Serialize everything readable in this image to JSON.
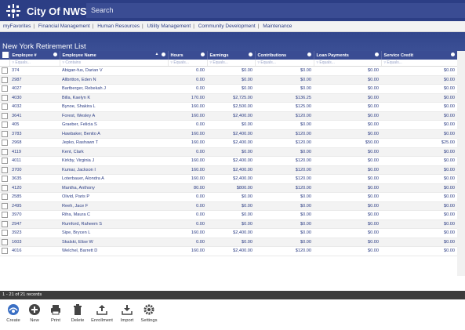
{
  "app": {
    "title": "City Of NWS",
    "search_placeholder": "Search"
  },
  "nav": {
    "items": [
      "myFavorites",
      "Financial Management",
      "Human Resources",
      "Utility Management",
      "Community Development",
      "Maintenance"
    ]
  },
  "page": {
    "title": "New York Retirement List"
  },
  "grid": {
    "columns": [
      "Employee #",
      "Employee Name",
      "Hours",
      "Earnings",
      "Contributions",
      "Loan Payments",
      "Service Credit"
    ],
    "filter_placeholders": [
      "Equals...",
      "Contains",
      "Equals...",
      "Equals...",
      "Equals...",
      "Equals...",
      "Equals..."
    ],
    "rows": [
      {
        "emp": "374",
        "name": "Abigan-fus, Darian V",
        "hours": "0.00",
        "earnings": "$0.00",
        "contrib": "$0.00",
        "loan": "$0.00",
        "credit": "$0.00"
      },
      {
        "emp": "2987",
        "name": "Allbritton, Eden N",
        "hours": "0.00",
        "earnings": "$0.00",
        "contrib": "$0.00",
        "loan": "$0.00",
        "credit": "$0.00"
      },
      {
        "emp": "4027",
        "name": "Bartberger, Rebekah J",
        "hours": "0.00",
        "earnings": "$0.00",
        "contrib": "$0.00",
        "loan": "$0.00",
        "credit": "$0.00"
      },
      {
        "emp": "4030",
        "name": "Billa, Kaelyn K",
        "hours": "170.00",
        "earnings": "$2,725.00",
        "contrib": "$136.25",
        "loan": "$0.00",
        "credit": "$0.00"
      },
      {
        "emp": "4032",
        "name": "Bynoe, Shakira L",
        "hours": "160.00",
        "earnings": "$2,500.00",
        "contrib": "$125.00",
        "loan": "$0.00",
        "credit": "$0.00"
      },
      {
        "emp": "3641",
        "name": "Forest, Wesley A",
        "hours": "160.00",
        "earnings": "$2,400.00",
        "contrib": "$120.00",
        "loan": "$0.00",
        "credit": "$0.00"
      },
      {
        "emp": "405",
        "name": "Graeber, Felicia S",
        "hours": "0.00",
        "earnings": "$0.00",
        "contrib": "$0.00",
        "loan": "$0.00",
        "credit": "$0.00"
      },
      {
        "emp": "3783",
        "name": "Hawbaker, Benito A",
        "hours": "160.00",
        "earnings": "$2,400.00",
        "contrib": "$120.00",
        "loan": "$0.00",
        "credit": "$0.00"
      },
      {
        "emp": "2968",
        "name": "Jepko, Rashawn T",
        "hours": "160.00",
        "earnings": "$2,400.00",
        "contrib": "$120.00",
        "loan": "$50.00",
        "credit": "$25.00"
      },
      {
        "emp": "4119",
        "name": "Kent, Clark",
        "hours": "0.00",
        "earnings": "$0.00",
        "contrib": "$0.00",
        "loan": "$0.00",
        "credit": "$0.00"
      },
      {
        "emp": "4011",
        "name": "Kirkby, Virginia J",
        "hours": "160.00",
        "earnings": "$2,400.00",
        "contrib": "$120.00",
        "loan": "$0.00",
        "credit": "$0.00"
      },
      {
        "emp": "3700",
        "name": "Kumar, Jackson I",
        "hours": "160.00",
        "earnings": "$2,400.00",
        "contrib": "$120.00",
        "loan": "$0.00",
        "credit": "$0.00"
      },
      {
        "emp": "3635",
        "name": "Loterbauer, Alondra A",
        "hours": "160.00",
        "earnings": "$2,400.00",
        "contrib": "$120.00",
        "loan": "$0.00",
        "credit": "$0.00"
      },
      {
        "emp": "4120",
        "name": "Mantha, Anthony",
        "hours": "80.00",
        "earnings": "$800.00",
        "contrib": "$120.00",
        "loan": "$0.00",
        "credit": "$0.00"
      },
      {
        "emp": "2585",
        "name": "Olivid, Paris P",
        "hours": "0.00",
        "earnings": "$0.00",
        "contrib": "$0.00",
        "loan": "$0.00",
        "credit": "$0.00"
      },
      {
        "emp": "2495",
        "name": "Reeh, Jace F",
        "hours": "0.00",
        "earnings": "$0.00",
        "contrib": "$0.00",
        "loan": "$0.00",
        "credit": "$0.00"
      },
      {
        "emp": "3970",
        "name": "Riha, Maura C",
        "hours": "0.00",
        "earnings": "$0.00",
        "contrib": "$0.00",
        "loan": "$0.00",
        "credit": "$0.00"
      },
      {
        "emp": "2947",
        "name": "Rumford, Raheem S",
        "hours": "0.00",
        "earnings": "$0.00",
        "contrib": "$0.00",
        "loan": "$0.00",
        "credit": "$0.00"
      },
      {
        "emp": "3923",
        "name": "Sipe, Brycen L",
        "hours": "160.00",
        "earnings": "$2,400.00",
        "contrib": "$0.00",
        "loan": "$0.00",
        "credit": "$0.00"
      },
      {
        "emp": "1603",
        "name": "Skalski, Elise W",
        "hours": "0.00",
        "earnings": "$0.00",
        "contrib": "$0.00",
        "loan": "$0.00",
        "credit": "$0.00"
      },
      {
        "emp": "4016",
        "name": "Welchel, Barrett D",
        "hours": "160.00",
        "earnings": "$2,400.00",
        "contrib": "$120.00",
        "loan": "$0.00",
        "credit": "$0.00"
      }
    ]
  },
  "status": {
    "records": "1 - 21 of 21 records"
  },
  "toolbar": {
    "create": "Create",
    "new": "New",
    "print": "Print",
    "delete": "Delete",
    "enrollment": "Enrollment",
    "import": "Import",
    "settings": "Settings"
  },
  "colors": {
    "brand": "#2c3e85",
    "header": "#3a4c93",
    "link": "#2d3e85"
  }
}
